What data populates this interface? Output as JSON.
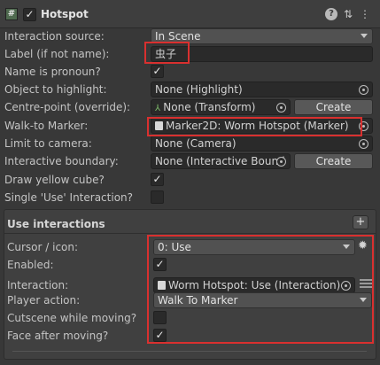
{
  "header": {
    "icon_glyph": "#",
    "enabled_check": "✓",
    "title": "Hotspot",
    "help_glyph": "?",
    "presets_glyph": "⇅",
    "menu_glyph": "⋮"
  },
  "rows": {
    "interaction_source": {
      "label": "Interaction source:",
      "value": "In Scene"
    },
    "label_field": {
      "label": "Label (if not name):",
      "value": "虫子"
    },
    "name_is_pronoun": {
      "label": "Name is pronoun?",
      "check": "✓"
    },
    "object_to_highlight": {
      "label": "Object to highlight:",
      "value": "None (Highlight)"
    },
    "centre_point": {
      "label": "Centre-point (override):",
      "value": "None (Transform)",
      "button": "Create"
    },
    "walk_to_marker": {
      "label": "Walk-to Marker:",
      "value": "Marker2D: Worm Hotspot (Marker)"
    },
    "limit_to_camera": {
      "label": "Limit to camera:",
      "value": "None (Camera)"
    },
    "interactive_boundary": {
      "label": "Interactive boundary:",
      "value": "None (Interactive Bound",
      "button": "Create"
    },
    "draw_yellow_cube": {
      "label": "Draw yellow cube?",
      "check": "✓"
    },
    "single_use": {
      "label": "Single 'Use' Interaction?",
      "check": ""
    }
  },
  "use_interactions": {
    "title": "Use interactions",
    "add_glyph": "+",
    "cursor": {
      "label": "Cursor / icon:",
      "value": "0: Use"
    },
    "enabled": {
      "label": "Enabled:",
      "check": "✓"
    },
    "interaction": {
      "label": "Interaction:",
      "value": "Worm Hotspot: Use (Interaction)"
    },
    "player_action": {
      "label": "Player action:",
      "value": "Walk To Marker"
    },
    "cutscene_while_moving": {
      "label": "Cutscene while moving?",
      "check": ""
    },
    "face_after_moving": {
      "label": "Face after moving?",
      "check": "✓"
    }
  },
  "colors": {
    "background": "#383838",
    "field": "#2a2a2a",
    "highlight_box": "#d9302f"
  }
}
